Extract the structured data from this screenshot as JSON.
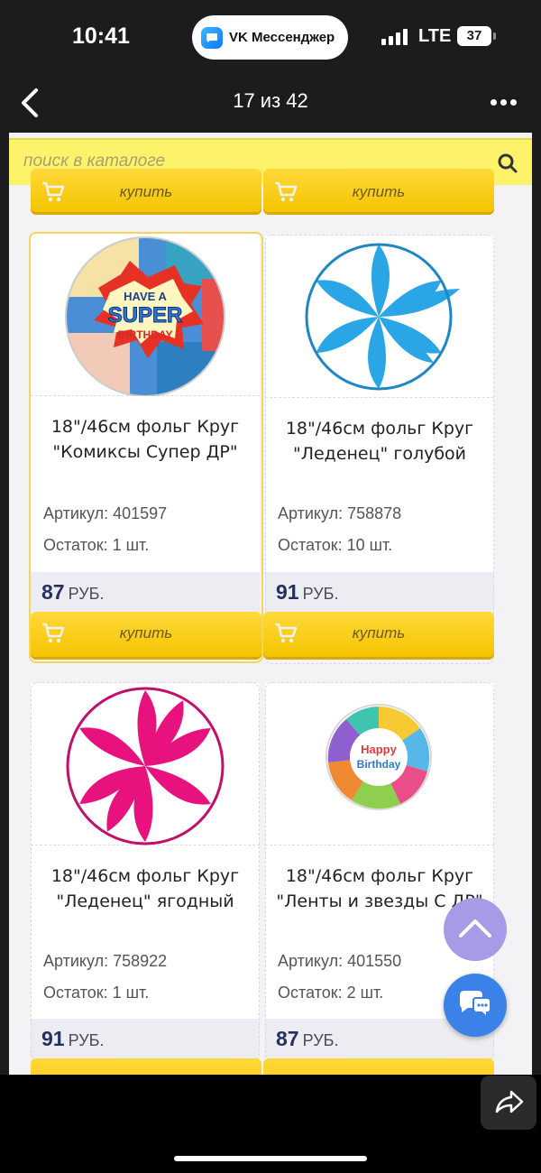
{
  "status": {
    "time": "10:41",
    "app_pill": "VK Мессенджер",
    "network": "LTE",
    "battery": "37"
  },
  "nav": {
    "counter": "17 из 42"
  },
  "search": {
    "placeholder": "поиск в каталоге"
  },
  "buy_label": "купить",
  "currency": "РУБ.",
  "products": [
    {
      "title_line1": "18\"/46см фольг Круг",
      "title_line2": "\"Комиксы Супер ДР\"",
      "sku": "Артикул: 401597",
      "stock": "Остаток: 1 шт.",
      "price": "87",
      "image": "comics-super-birthday-balloon",
      "image_text": [
        "HAVE A",
        "SUPER",
        "BIRTHDAY"
      ]
    },
    {
      "title_line1": "18\"/46см фольг Круг",
      "title_line2": "\"Леденец\" голубой",
      "sku": "Артикул: 758878",
      "stock": "Остаток: 10 шт.",
      "price": "91",
      "image": "blue-swirl-lollipop-balloon",
      "color": "#2aa6e6"
    },
    {
      "title_line1": "18\"/46см фольг Круг",
      "title_line2": "\"Леденец\" ягодный",
      "sku": "Артикул: 758922",
      "stock": "Остаток: 1 шт.",
      "price": "91",
      "image": "berry-swirl-lollipop-balloon",
      "color": "#e8127e"
    },
    {
      "title_line1": "18\"/46см фольг Круг",
      "title_line2": "\"Ленты и звезды С ДР\"",
      "sku": "Артикул: 401550",
      "stock": "Остаток: 2 шт.",
      "price": "87",
      "image": "ribbons-stars-happy-birthday-balloon",
      "image_text": [
        "Happy",
        "Birthday"
      ]
    }
  ]
}
